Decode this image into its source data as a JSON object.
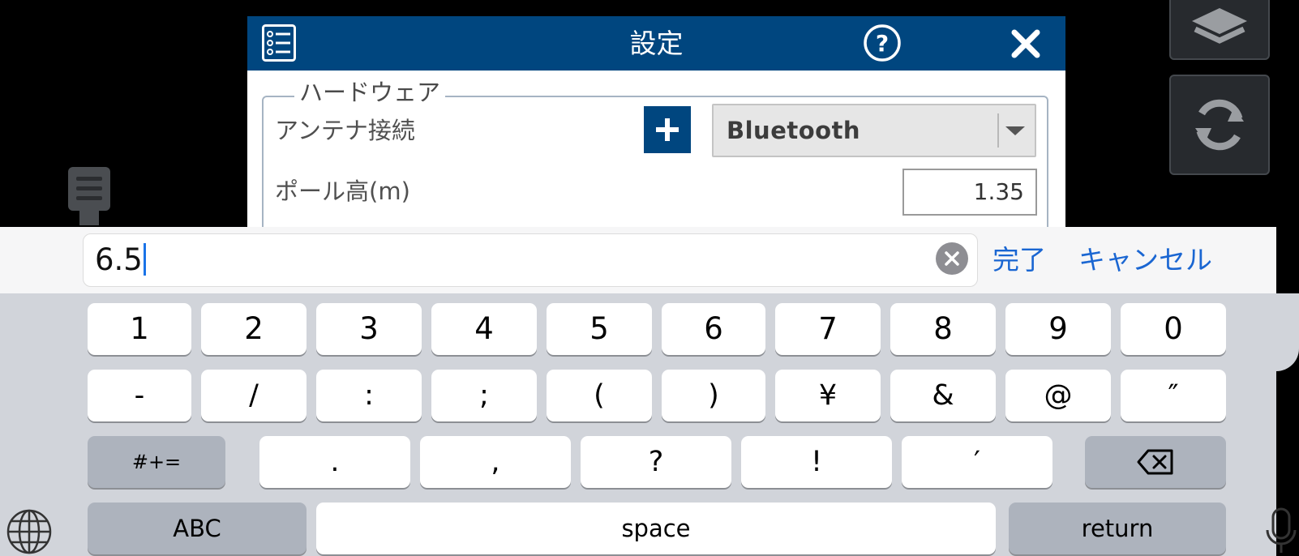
{
  "dialog": {
    "title": "設定",
    "group_label": "ハードウェア",
    "antenna_label": "アンテナ接続",
    "antenna_value": "Bluetooth",
    "pole_label": "ポール高(m)",
    "pole_value": "1.35"
  },
  "accessory": {
    "input_value": "6.5",
    "done_label": "完了",
    "cancel_label": "キャンセル"
  },
  "keyboard": {
    "row_numbers": [
      "1",
      "2",
      "3",
      "4",
      "5",
      "6",
      "7",
      "8",
      "9",
      "0"
    ],
    "row_symbols": [
      "-",
      "/",
      ":",
      ";",
      "(",
      ")",
      "¥",
      "&",
      "@",
      "″"
    ],
    "row_punct": [
      ".",
      ",",
      "?",
      "!",
      "′"
    ],
    "more_symbols_label": "#+=",
    "abc_label": "ABC",
    "space_label": "space",
    "return_label": "return"
  },
  "colors": {
    "header_blue": "#00467f",
    "link_blue": "#1a66d2",
    "keyboard_bg": "#d1d4da"
  },
  "icons": [
    "menu-list-icon",
    "help-icon",
    "close-icon",
    "plus-icon",
    "chevron-down-icon",
    "layers-icon",
    "refresh-icon",
    "drag-handle-icon",
    "clear-icon",
    "backspace-icon",
    "globe-icon",
    "microphone-icon"
  ]
}
